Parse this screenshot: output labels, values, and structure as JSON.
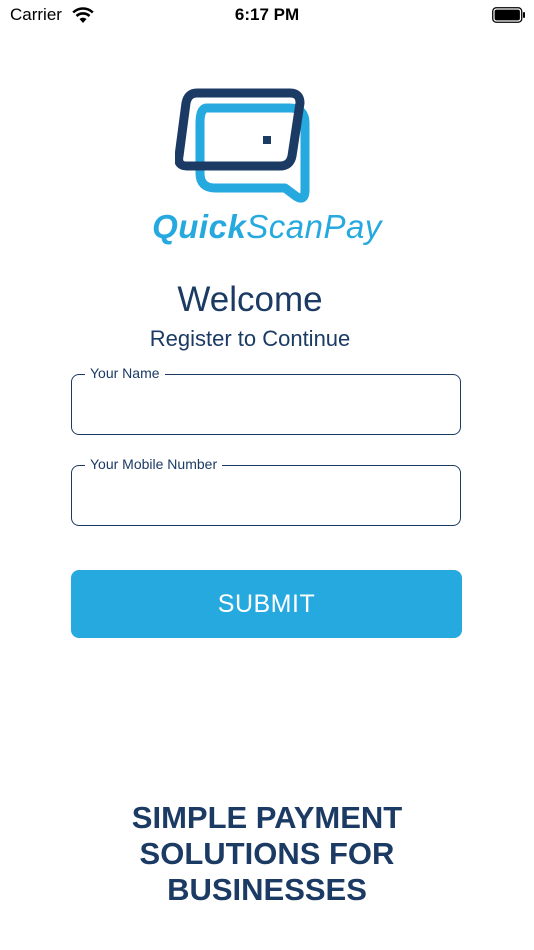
{
  "status_bar": {
    "carrier": "Carrier",
    "time": "6:17 PM"
  },
  "brand": {
    "part1": "Quick",
    "part2": "Scan",
    "part3": "Pay",
    "colors": {
      "primary": "#26a9df",
      "dark": "#1b3a64"
    }
  },
  "welcome": {
    "title": "Welcome",
    "subtitle": "Register to Continue"
  },
  "form": {
    "name_label": "Your Name",
    "name_value": "",
    "mobile_label": "Your Mobile Number",
    "mobile_value": "",
    "submit_label": "SUBMIT"
  },
  "tagline": {
    "lines": [
      "SIMPLE PAYMENT",
      "SOLUTIONS FOR",
      "BUSINESSES"
    ]
  },
  "icons": [
    "wifi-icon",
    "battery-icon",
    "quickscanpay-logo-icon"
  ]
}
